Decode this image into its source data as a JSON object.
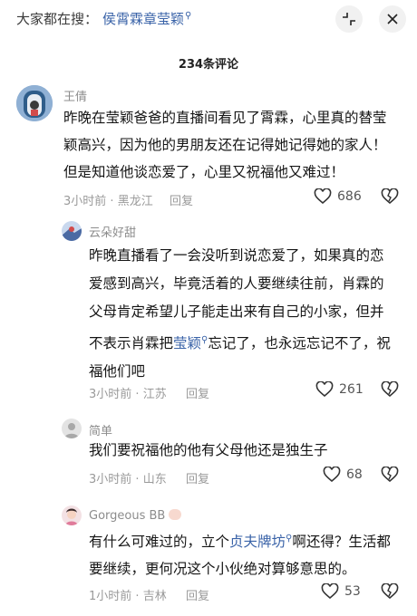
{
  "search": {
    "prefix": "大家都在搜：",
    "keyword": "侯霄霖章莹颖",
    "search_icon": "search-icon"
  },
  "header": {
    "comment_count": "234条评论",
    "collapse_icon": "collapse-icon",
    "close_icon": "close-icon"
  },
  "colors": {
    "link": "#3a63a8",
    "meta": "#9a9a9a"
  },
  "comments": [
    {
      "author": "王倩",
      "lines": [
        "昨晚在莹颖爸爸的直播间看见了霄霖，心里真的替莹",
        "颖高兴，因为他的男朋友还在记得她记得她的家人！",
        "但是知道他谈恋爱了，心里又祝福他又难过！"
      ],
      "time": "3小时前",
      "location": "黑龙江",
      "reply_label": "回复",
      "likes": "686"
    },
    {
      "author": "云朵好甜",
      "lines": [
        "昨晚直播看了一会没听到说恋爱了，如果真的恋",
        "爱感到高兴，毕竟活着的人要继续往前，肖霖的",
        "父母肯定希望儿子能走出来有自己的小家，但并",
        "不表示肖霖把",
        "莹颖",
        "忘记了，也永远忘记不了，祝",
        "福他们吧"
      ],
      "time": "3小时前",
      "location": "江苏",
      "reply_label": "回复",
      "likes": "261"
    },
    {
      "author": "简单",
      "lines": [
        "我们要祝福他的他有父母他还是独生子"
      ],
      "time": "3小时前",
      "location": "山东",
      "reply_label": "回复",
      "likes": "68"
    },
    {
      "author": "Gorgeous BB",
      "lines": [
        "有什么可难过的，立个",
        "贞夫牌坊",
        "啊还得？生活都",
        "要继续，更何况这个小伙绝对算够意思的。"
      ],
      "time": "1小时前",
      "location": "吉林",
      "reply_label": "回复",
      "likes": "53"
    }
  ]
}
